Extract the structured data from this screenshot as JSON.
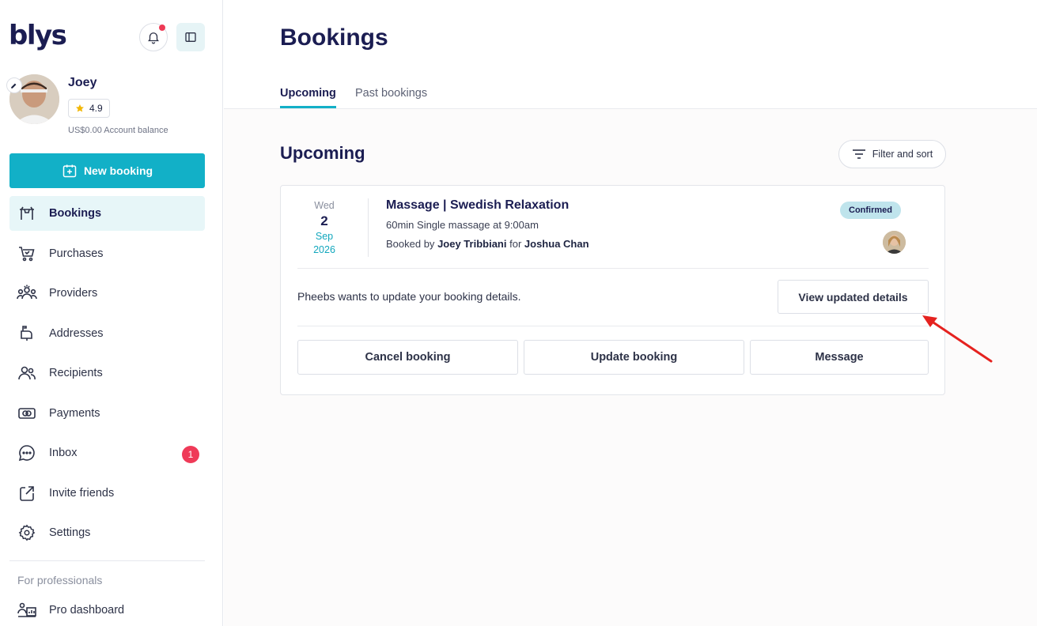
{
  "app": {
    "logo_text": "blys"
  },
  "user": {
    "name": "Joey",
    "rating": "4.9",
    "balance": "US$0.00 Account balance"
  },
  "sidebar": {
    "new_booking_label": "New booking",
    "items": [
      {
        "label": "Bookings",
        "icon": "bookings-icon",
        "active": true
      },
      {
        "label": "Purchases",
        "icon": "cart-icon"
      },
      {
        "label": "Providers",
        "icon": "providers-icon"
      },
      {
        "label": "Addresses",
        "icon": "mailbox-icon"
      },
      {
        "label": "Recipients",
        "icon": "recipients-icon"
      },
      {
        "label": "Payments",
        "icon": "payments-icon"
      },
      {
        "label": "Inbox",
        "icon": "chat-icon",
        "badge": "1"
      },
      {
        "label": "Invite friends",
        "icon": "share-icon"
      },
      {
        "label": "Settings",
        "icon": "gear-icon"
      }
    ],
    "section_label": "For professionals",
    "pro_dashboard_label": "Pro dashboard"
  },
  "main": {
    "title": "Bookings",
    "tabs": [
      {
        "label": "Upcoming",
        "active": true
      },
      {
        "label": "Past bookings"
      }
    ],
    "section_title": "Upcoming",
    "filter_label": "Filter and sort"
  },
  "booking": {
    "date": {
      "dow": "Wed",
      "day": "2",
      "month": "Sep",
      "year": "2026"
    },
    "title": "Massage | Swedish Relaxation",
    "subtitle": "60min Single massage at 9:00am",
    "booked_by_prefix": "Booked by",
    "booked_by": "Joey Tribbiani",
    "for_prefix": "for",
    "recipient": "Joshua Chan",
    "status": "Confirmed",
    "notice": "Pheebs wants to update your booking details.",
    "view_updated_label": "View updated details",
    "actions": {
      "cancel": "Cancel booking",
      "update": "Update booking",
      "message": "Message"
    }
  },
  "colors": {
    "brand_navy": "#1b1d52",
    "accent_teal": "#12b0c7",
    "badge_red": "#ef3a58",
    "status_bg": "#bfe4ec",
    "annotation_arrow": "#e5221f"
  }
}
